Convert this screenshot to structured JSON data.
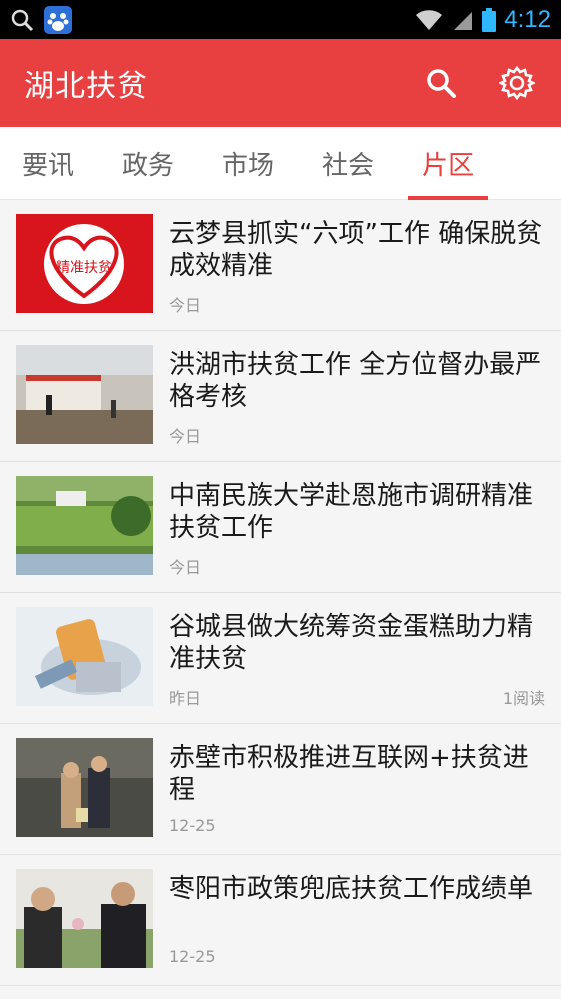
{
  "status_bar": {
    "time": "4:12"
  },
  "app_bar": {
    "title": "湖北扶贫",
    "search_icon": "search-icon",
    "settings_icon": "gear-icon"
  },
  "tabs": [
    {
      "label": "要讯"
    },
    {
      "label": "政务"
    },
    {
      "label": "市场"
    },
    {
      "label": "社会"
    },
    {
      "label": "片区"
    }
  ],
  "active_tab": "片区",
  "colors": {
    "accent": "#e84040",
    "status_blue": "#2fb8ff"
  },
  "articles": [
    {
      "title": "云梦县抓实“六项”工作 确保脱贫成效精准",
      "date": "今日",
      "reads": "",
      "thumb_text": "精准扶贫"
    },
    {
      "title": "洪湖市扶贫工作 全方位督办最严格考核",
      "date": "今日",
      "reads": ""
    },
    {
      "title": "中南民族大学赴恩施市调研精准扶贫工作",
      "date": "今日",
      "reads": ""
    },
    {
      "title": "谷城县做大统筹资金蛋糕助力精准扶贫",
      "date": "昨日",
      "reads": "1阅读"
    },
    {
      "title": "赤壁市积极推进互联网+扶贫进程",
      "date": "12-25",
      "reads": ""
    },
    {
      "title": "枣阳市政策兜底扶贫工作成绩单",
      "date": "12-25",
      "reads": ""
    }
  ]
}
